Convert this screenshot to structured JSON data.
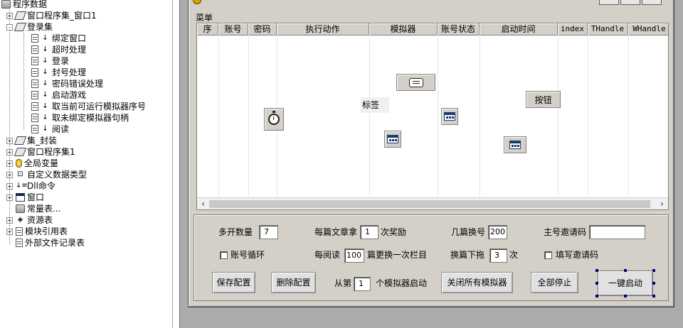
{
  "tree": {
    "items": [
      {
        "label": "程序数据",
        "icon": "database-icon",
        "expander": ""
      },
      {
        "label": "窗口程序集_窗口1",
        "icon": "assembly-icon",
        "expander": "+"
      },
      {
        "label": "登录集",
        "icon": "assembly-icon",
        "expander": "-"
      },
      {
        "label": "绑定窗口",
        "icon": "sub-icon",
        "expander": ""
      },
      {
        "label": "超时处理",
        "icon": "sub-icon",
        "expander": ""
      },
      {
        "label": "登录",
        "icon": "sub-icon",
        "expander": ""
      },
      {
        "label": "封号处理",
        "icon": "sub-icon",
        "expander": ""
      },
      {
        "label": "密码错误处理",
        "icon": "sub-icon",
        "expander": ""
      },
      {
        "label": "启动游戏",
        "icon": "sub-icon",
        "expander": ""
      },
      {
        "label": "取当前可运行模拟器序号",
        "icon": "sub-icon",
        "expander": ""
      },
      {
        "label": "取未绑定模拟器句柄",
        "icon": "sub-icon",
        "expander": ""
      },
      {
        "label": "阅读",
        "icon": "sub-icon",
        "expander": ""
      },
      {
        "label": "集_封装",
        "icon": "assembly-icon",
        "expander": "+"
      },
      {
        "label": "窗口程序集1",
        "icon": "assembly-icon",
        "expander": "+"
      },
      {
        "label": "全局变量",
        "icon": "variable-icon",
        "expander": "+"
      },
      {
        "label": "自定义数据类型",
        "icon": "datatype-icon",
        "expander": "+"
      },
      {
        "label": "Dll命令",
        "icon": "dll-icon",
        "expander": "+"
      },
      {
        "label": "窗口",
        "icon": "window-icon",
        "expander": "+"
      },
      {
        "label": "常量表...",
        "icon": "constant-icon",
        "expander": ""
      },
      {
        "label": "资源表",
        "icon": "resource-icon",
        "expander": "+"
      },
      {
        "label": "模块引用表",
        "icon": "module-icon",
        "expander": "+"
      },
      {
        "label": "外部文件记录表",
        "icon": "file-icon",
        "expander": ""
      }
    ]
  },
  "window": {
    "menu_label": "菜单",
    "grid_columns": [
      "序",
      "账号",
      "密码",
      "执行动作",
      "模拟器",
      "账号状态",
      "启动时间",
      "index",
      "THandle",
      "WHandle"
    ],
    "label_control": "标签",
    "button_control": "按钮"
  },
  "panel": {
    "multi_open_label": "多开数量",
    "multi_open_value": "7",
    "per_article_label": "每篇文章拿",
    "per_article_value": "1",
    "reward_suffix": "次奖励",
    "switch_after_label": "几篇换号",
    "switch_after_value": "200",
    "main_invite_label": "主号邀请码",
    "main_invite_value": "",
    "loop_accounts_label": "账号循环",
    "per_read_label": "每阅读",
    "per_read_value": "100",
    "column_change_suffix": "篇更换一次栏目",
    "swipe_down_label": "换篇下拖",
    "swipe_down_value": "3",
    "times_suffix": "次",
    "fill_invite_label": "填写邀请码",
    "from_label": "从第",
    "from_value": "1",
    "start_suffix": "个模拟器启动",
    "save_config": "保存配置",
    "delete_config": "删除配置",
    "close_all": "关闭所有模拟器",
    "stop_all": "全部停止",
    "one_click_start": "一键启动"
  }
}
